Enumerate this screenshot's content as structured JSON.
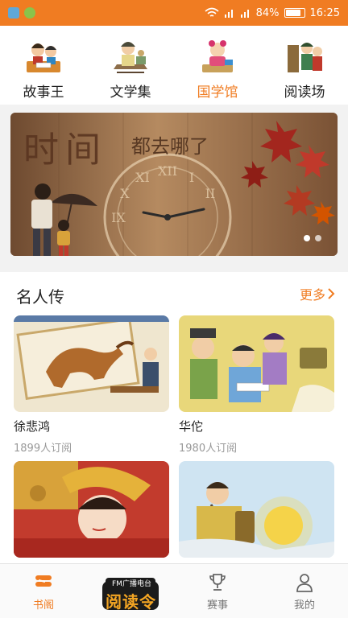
{
  "status_bar": {
    "signal_percent": "84%",
    "time": "16:25",
    "battery_level": 0.84
  },
  "categories": [
    {
      "label": "故事王",
      "icon": "story-king-icon",
      "active": false
    },
    {
      "label": "文学集",
      "icon": "literature-icon",
      "active": false
    },
    {
      "label": "国学馆",
      "icon": "chinese-classics-icon",
      "active": true
    },
    {
      "label": "阅读场",
      "icon": "reading-field-icon",
      "active": false
    }
  ],
  "banner": {
    "title": "时间",
    "subtitle": "都去哪了",
    "page_count": 2,
    "active_index": 0
  },
  "section": {
    "title": "名人传",
    "more_label": "更多",
    "cards": [
      {
        "name": "徐悲鸿",
        "subscribers": "1899人订阅"
      },
      {
        "name": "华佗",
        "subscribers": "1980人订阅"
      },
      {
        "name": "",
        "subscribers": ""
      },
      {
        "name": "",
        "subscribers": ""
      }
    ]
  },
  "bottom_nav": {
    "tabs": [
      {
        "label": "书阁",
        "icon": "book-pavilion-icon",
        "active": true
      },
      {
        "label": "",
        "icon": "fm-radio-logo",
        "active": false
      },
      {
        "label": "赛事",
        "icon": "trophy-icon",
        "active": false
      },
      {
        "label": "我的",
        "icon": "user-icon",
        "active": false
      }
    ],
    "logo": {
      "top": "FM广播电台",
      "main": "阅读令"
    }
  },
  "colors": {
    "accent": "#f07c22",
    "text": "#222222",
    "muted": "#999999"
  }
}
